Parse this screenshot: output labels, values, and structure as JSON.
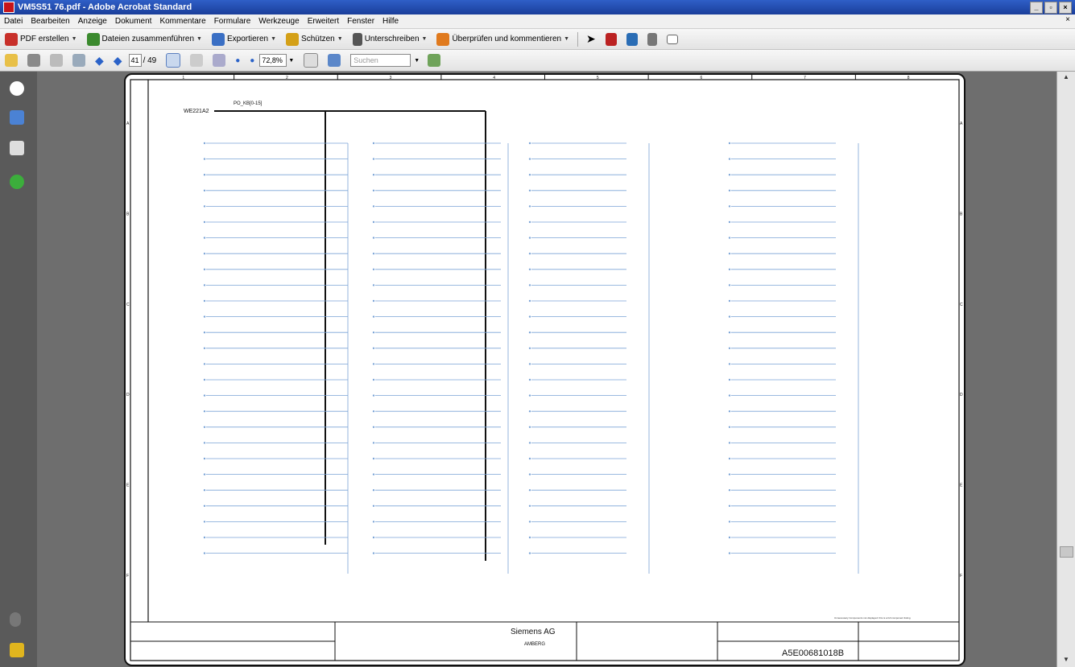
{
  "window": {
    "title": "VM5S51 76.pdf - Adobe Acrobat Standard",
    "buttons": [
      "_",
      "▫",
      "×"
    ]
  },
  "menu": [
    "Datei",
    "Bearbeiten",
    "Anzeige",
    "Dokument",
    "Kommentare",
    "Formulare",
    "Werkzeuge",
    "Erweitert",
    "Fenster",
    "Hilfe"
  ],
  "menu_close": "×",
  "toolbar1": {
    "pdf_create": "PDF erstellen",
    "combine": "Dateien zusammenführen",
    "export": "Exportieren",
    "protect": "Schützen",
    "sign": "Unterschreiben",
    "review": "Überprüfen und kommentieren"
  },
  "toolbar2": {
    "page_current": "41",
    "page_count": "/ 49",
    "zoom": "72,8%",
    "search_placeholder": "Suchen"
  },
  "drawing": {
    "top_net_label": "WE221A2",
    "top_net_name": "PO_KB[0-15]",
    "grid_numbers": [
      "1",
      "2",
      "3",
      "4",
      "5",
      "6",
      "7",
      "8"
    ],
    "grid_letters": [
      "A",
      "B",
      "C",
      "D",
      "E",
      "F"
    ],
    "title_block": {
      "company": "Siemens AG",
      "city": "AMBERG",
      "doc_number": "A5E00681018B",
      "bottom_note": "Unnecessary Components not displayed: this is a full component listing"
    }
  }
}
